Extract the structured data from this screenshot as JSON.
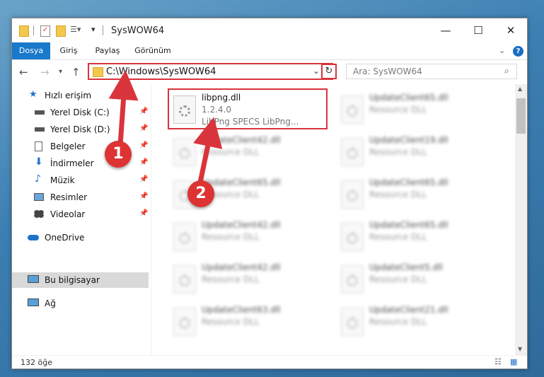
{
  "titlebar": {
    "title": "SysWOW64"
  },
  "ribbon": {
    "tabs": [
      "Dosya",
      "Giriş",
      "Paylaş",
      "Görünüm"
    ]
  },
  "address": {
    "path": "C:\\Windows\\SysWOW64",
    "search_placeholder": "Ara: SysWOW64"
  },
  "sidebar": {
    "items": [
      {
        "label": "Hızlı erişim"
      },
      {
        "label": "Yerel Disk (C:)"
      },
      {
        "label": "Yerel Disk (D:)"
      },
      {
        "label": "Belgeler"
      },
      {
        "label": "İndirmeler"
      },
      {
        "label": "Müzik"
      },
      {
        "label": "Resimler"
      },
      {
        "label": "Videolar"
      },
      {
        "label": "OneDrive"
      },
      {
        "label": "Bu bilgisayar"
      },
      {
        "label": "Ağ"
      }
    ]
  },
  "files": {
    "highlighted": {
      "name": "libpng.dll",
      "version": "1.2.4.0",
      "desc": "LibPng SPECS LibPng..."
    },
    "left": [
      {
        "name": "UpdateClient42.dll",
        "desc": "Resource DLL"
      },
      {
        "name": "UpdateClient65.dll",
        "desc": "Resource DLL"
      },
      {
        "name": "UpdateClient42.dll",
        "desc": "Resource DLL"
      },
      {
        "name": "UpdateClient42.dll",
        "desc": "Resource DLL"
      },
      {
        "name": "UpdateClient63.dll",
        "desc": "Resource DLL"
      }
    ],
    "right": [
      {
        "name": "UpdateClient65.dll",
        "desc": "Resource DLL"
      },
      {
        "name": "UpdateClient19.dll",
        "desc": "Resource DLL"
      },
      {
        "name": "UpdateClient65.dll",
        "desc": "Resource DLL"
      },
      {
        "name": "UpdateClient65.dll",
        "desc": "Resource DLL"
      },
      {
        "name": "UpdateClient5.dll",
        "desc": "Resource DLL"
      },
      {
        "name": "UpdateClient21.dll",
        "desc": "Resource DLL"
      }
    ]
  },
  "status": {
    "count": "132 öğe"
  },
  "markers": [
    "1",
    "2"
  ]
}
